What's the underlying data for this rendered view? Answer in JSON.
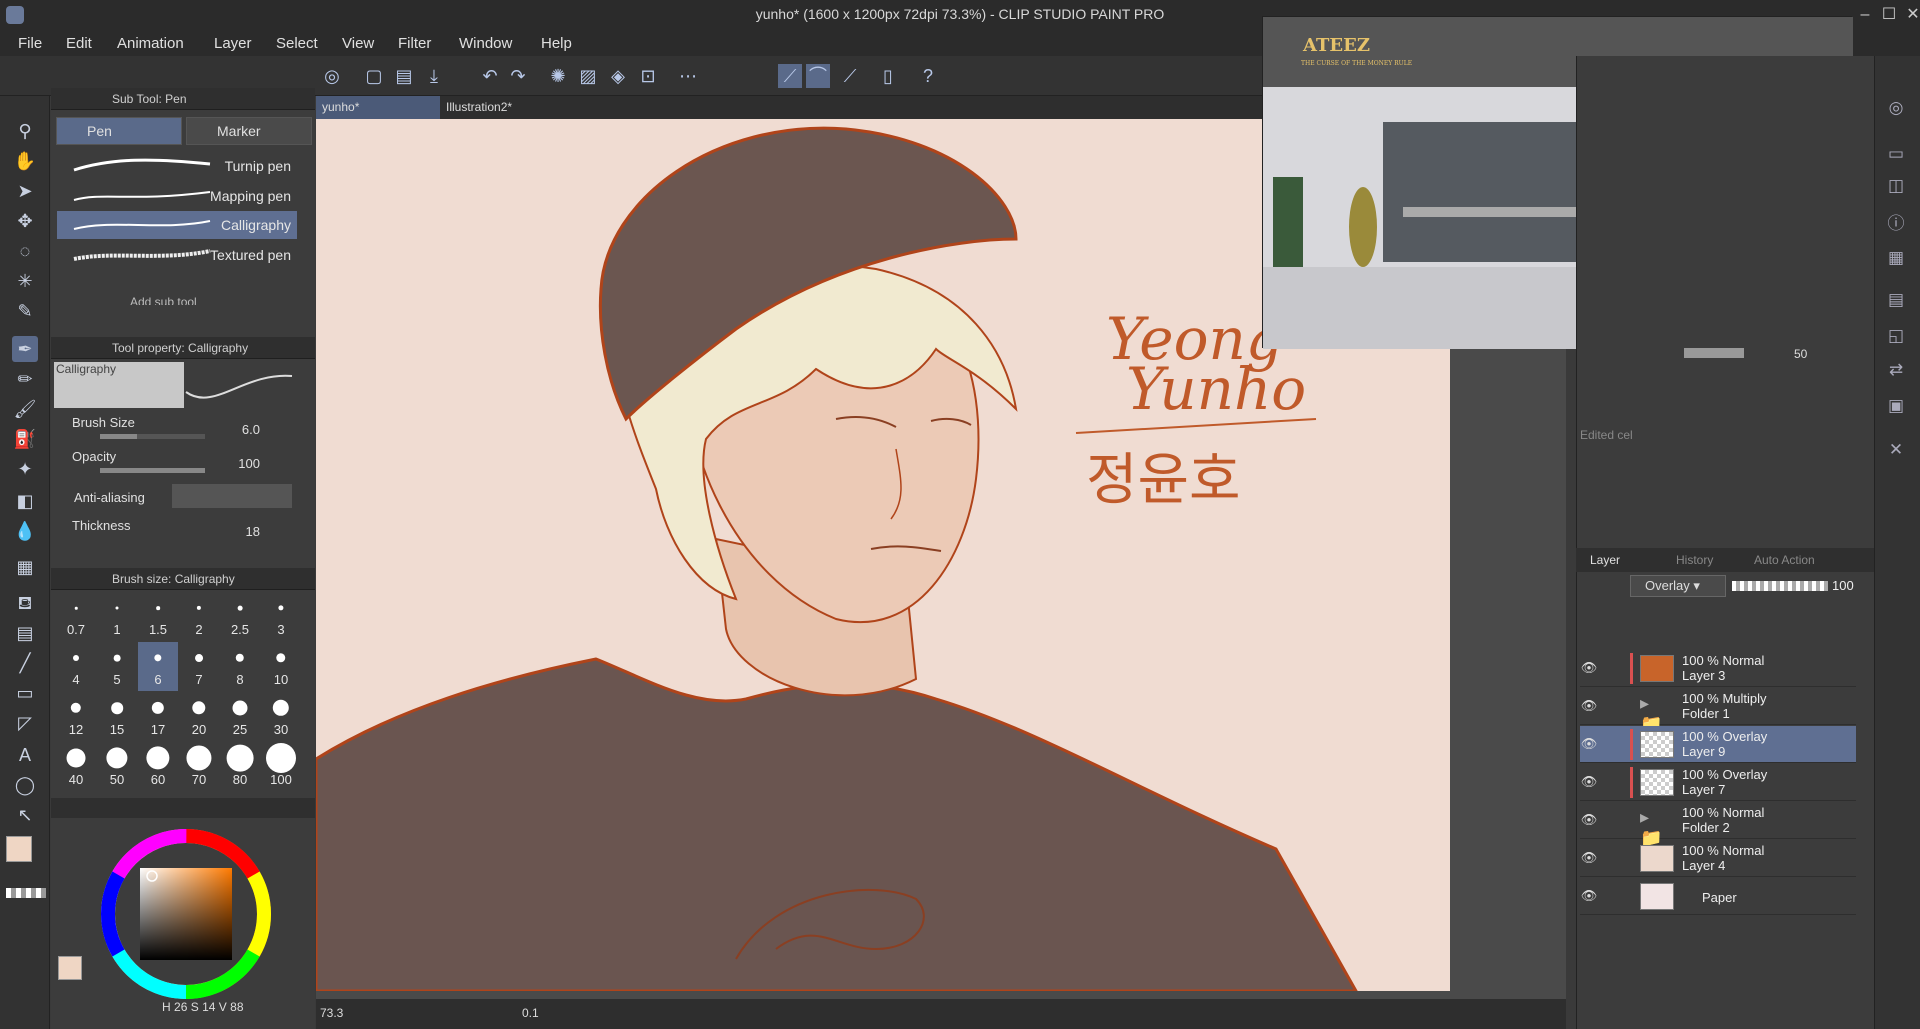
{
  "window": {
    "title": "yunho* (1600 x 1200px 72dpi 73.3%)  - CLIP STUDIO PAINT PRO"
  },
  "menu": [
    "File",
    "Edit",
    "Animation",
    "Layer",
    "Select",
    "View",
    "Filter",
    "Window",
    "Help"
  ],
  "subtool": {
    "header": "Sub Tool: Pen",
    "tabs": [
      "Pen",
      "Marker"
    ],
    "items": [
      "Turnip pen",
      "Mapping pen",
      "Calligraphy",
      "Textured pen"
    ],
    "selected": "Calligraphy",
    "add_label": "Add sub tool"
  },
  "tool_property": {
    "header": "Tool property: Calligraphy",
    "preview_label": "Calligraphy",
    "brush_size_label": "Brush Size",
    "brush_size_value": "6.0",
    "opacity_label": "Opacity",
    "opacity_value": "100",
    "antialias_label": "Anti-aliasing",
    "thickness_label": "Thickness",
    "thickness_value": "18"
  },
  "brush_size": {
    "header": "Brush size: Calligraphy",
    "sizes": [
      "0.7",
      "1",
      "1.5",
      "2",
      "2.5",
      "3",
      "4",
      "5",
      "6",
      "7",
      "8",
      "10",
      "12",
      "15",
      "17",
      "20",
      "25",
      "30",
      "40",
      "50",
      "60",
      "70",
      "80",
      "100"
    ],
    "selected": "6"
  },
  "color": {
    "main": "#efd6c4",
    "sub": "#ffffff",
    "readout": {
      "h_label": "H",
      "h": "26",
      "s_label": "S",
      "s": "14",
      "v_label": "V",
      "v": "88"
    }
  },
  "doc_tabs": [
    "yunho*",
    "Illustration2*"
  ],
  "artwork": {
    "signature_line1": "Yeong",
    "signature_line2": "Yunho",
    "signature_korean": "정윤호"
  },
  "video": {
    "logo_line1": "ATEEZ",
    "logo_line2": "THE CURSE OF THE MONEY RULE"
  },
  "animation_cels": {
    "opacity_value": "50",
    "edited_cel_label": "Edited cel"
  },
  "layer_panel": {
    "tabs": [
      "Layer",
      "History",
      "Auto Action"
    ],
    "blend_mode": "Overlay",
    "opacity": "100",
    "layers": [
      {
        "mode": "100 % Normal",
        "name": "Layer 3",
        "thumb": "#c8642a",
        "folder": false,
        "marker": true
      },
      {
        "mode": "100 % Multiply",
        "name": "Folder 1",
        "thumb": "",
        "folder": true,
        "marker": false
      },
      {
        "mode": "100 % Overlay",
        "name": "Layer 9",
        "thumb": "checker",
        "folder": false,
        "marker": true
      },
      {
        "mode": "100 % Overlay",
        "name": "Layer 7",
        "thumb": "checker",
        "folder": false,
        "marker": true
      },
      {
        "mode": "100 % Normal",
        "name": "Folder 2",
        "thumb": "",
        "folder": true,
        "marker": false
      },
      {
        "mode": "100 % Normal",
        "name": "Layer 4",
        "thumb": "#ecd8cc",
        "folder": false,
        "marker": false
      },
      {
        "mode": "",
        "name": "Paper",
        "thumb": "#f2e4e4",
        "folder": false,
        "marker": false
      }
    ],
    "selected_index": 2
  },
  "status": {
    "zoom": "73.3",
    "rotation": "0.1"
  }
}
